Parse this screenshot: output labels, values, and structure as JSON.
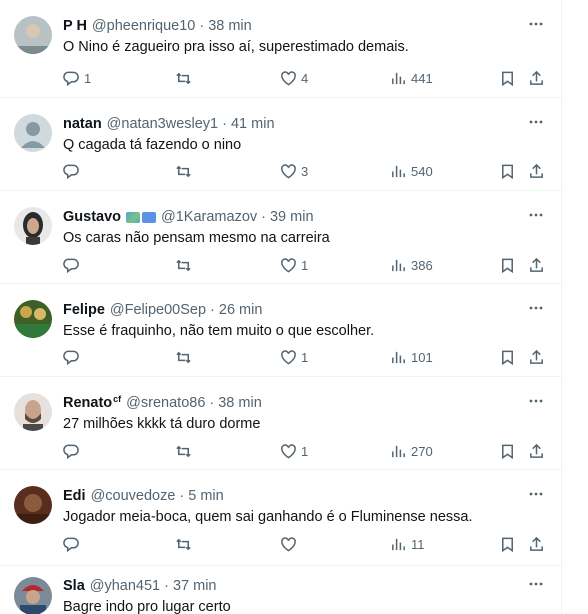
{
  "tweets": [
    {
      "name": "P H",
      "handle": "@pheenrique10",
      "time": "38 min",
      "text": "O Nino é zagueiro pra isso aí, superestimado demais.",
      "replies": "1",
      "retweets": "",
      "likes": "4",
      "views": "441",
      "avatar_color": "#9aa7a8",
      "avatar_icon": "photo-avatar"
    },
    {
      "name": "natan",
      "handle": "@natan3wesley1",
      "time": "41 min",
      "text": "Q cagada tá fazendo o nino",
      "replies": "",
      "retweets": "",
      "likes": "3",
      "views": "540",
      "avatar_color": "#cfd9de",
      "avatar_icon": "default-avatar"
    },
    {
      "name": "Gustavo",
      "handle": "@1Karamazov",
      "time": "39 min",
      "text": "Os caras não pensam mesmo na carreira",
      "replies": "",
      "retweets": "",
      "likes": "1",
      "views": "386",
      "avatar_color": "#3a3a3a",
      "avatar_icon": "photo-avatar",
      "badges": [
        "map-emoji-badge",
        "un-flag-badge"
      ]
    },
    {
      "name": "Felipe",
      "handle": "@Felipe00Sep",
      "time": "26 min",
      "text": "Esse é fraquinho, não tem muito o que escolher.",
      "replies": "",
      "retweets": "",
      "likes": "1",
      "views": "101",
      "avatar_color": "#4c6b2e",
      "avatar_icon": "photo-avatar"
    },
    {
      "name": "Renato",
      "name_suffix": "cf",
      "handle": "@srenato86",
      "time": "38 min",
      "text": "27 milhões kkkk tá duro dorme",
      "replies": "",
      "retweets": "",
      "likes": "1",
      "views": "270",
      "avatar_color": "#c9bfb4",
      "avatar_icon": "photo-avatar"
    },
    {
      "name": "Edi",
      "handle": "@couvedoze",
      "time": "5 min",
      "text": "Jogador meia-boca, quem sai ganhando é o Fluminense nessa.",
      "replies": "",
      "retweets": "",
      "likes": "",
      "views": "11",
      "avatar_color": "#6b3a2a",
      "avatar_icon": "photo-avatar"
    },
    {
      "name": "Sla",
      "handle": "@yhan451",
      "time": "37 min",
      "text": "Bagre indo pro lugar certo",
      "replies": "",
      "retweets": "",
      "likes": "",
      "views": "",
      "avatar_color": "#8a2a2a",
      "avatar_icon": "photo-avatar"
    }
  ],
  "separator": "·",
  "accent_color": "#536471"
}
